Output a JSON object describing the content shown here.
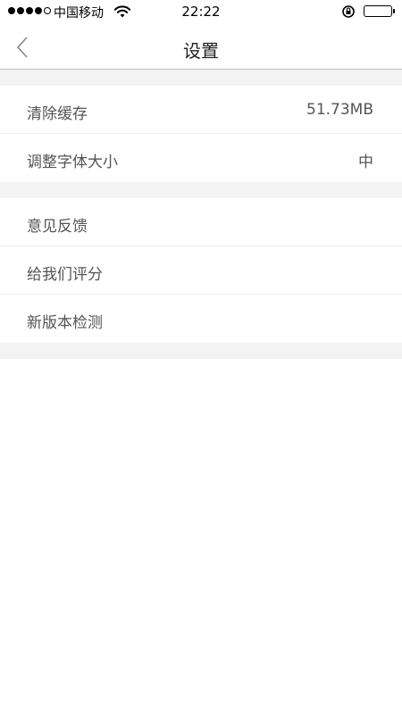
{
  "status_bar": {
    "carrier": "中国移动",
    "time": "22:22",
    "signal_bars_filled": 4,
    "signal_bars_total": 5,
    "battery_level": 1.0
  },
  "nav": {
    "title": "设置",
    "back_icon": "chevron-left-icon"
  },
  "groups": [
    {
      "items": [
        {
          "label": "清除缓存",
          "value": "51.73MB"
        },
        {
          "label": "调整字体大小",
          "value": "中"
        }
      ]
    },
    {
      "items": [
        {
          "label": "意见反馈",
          "value": ""
        },
        {
          "label": "给我们评分",
          "value": ""
        },
        {
          "label": "新版本检测",
          "value": ""
        }
      ]
    }
  ],
  "colors": {
    "separator_bg": "#f3f3f3",
    "text": "#555555",
    "title": "#222222"
  }
}
